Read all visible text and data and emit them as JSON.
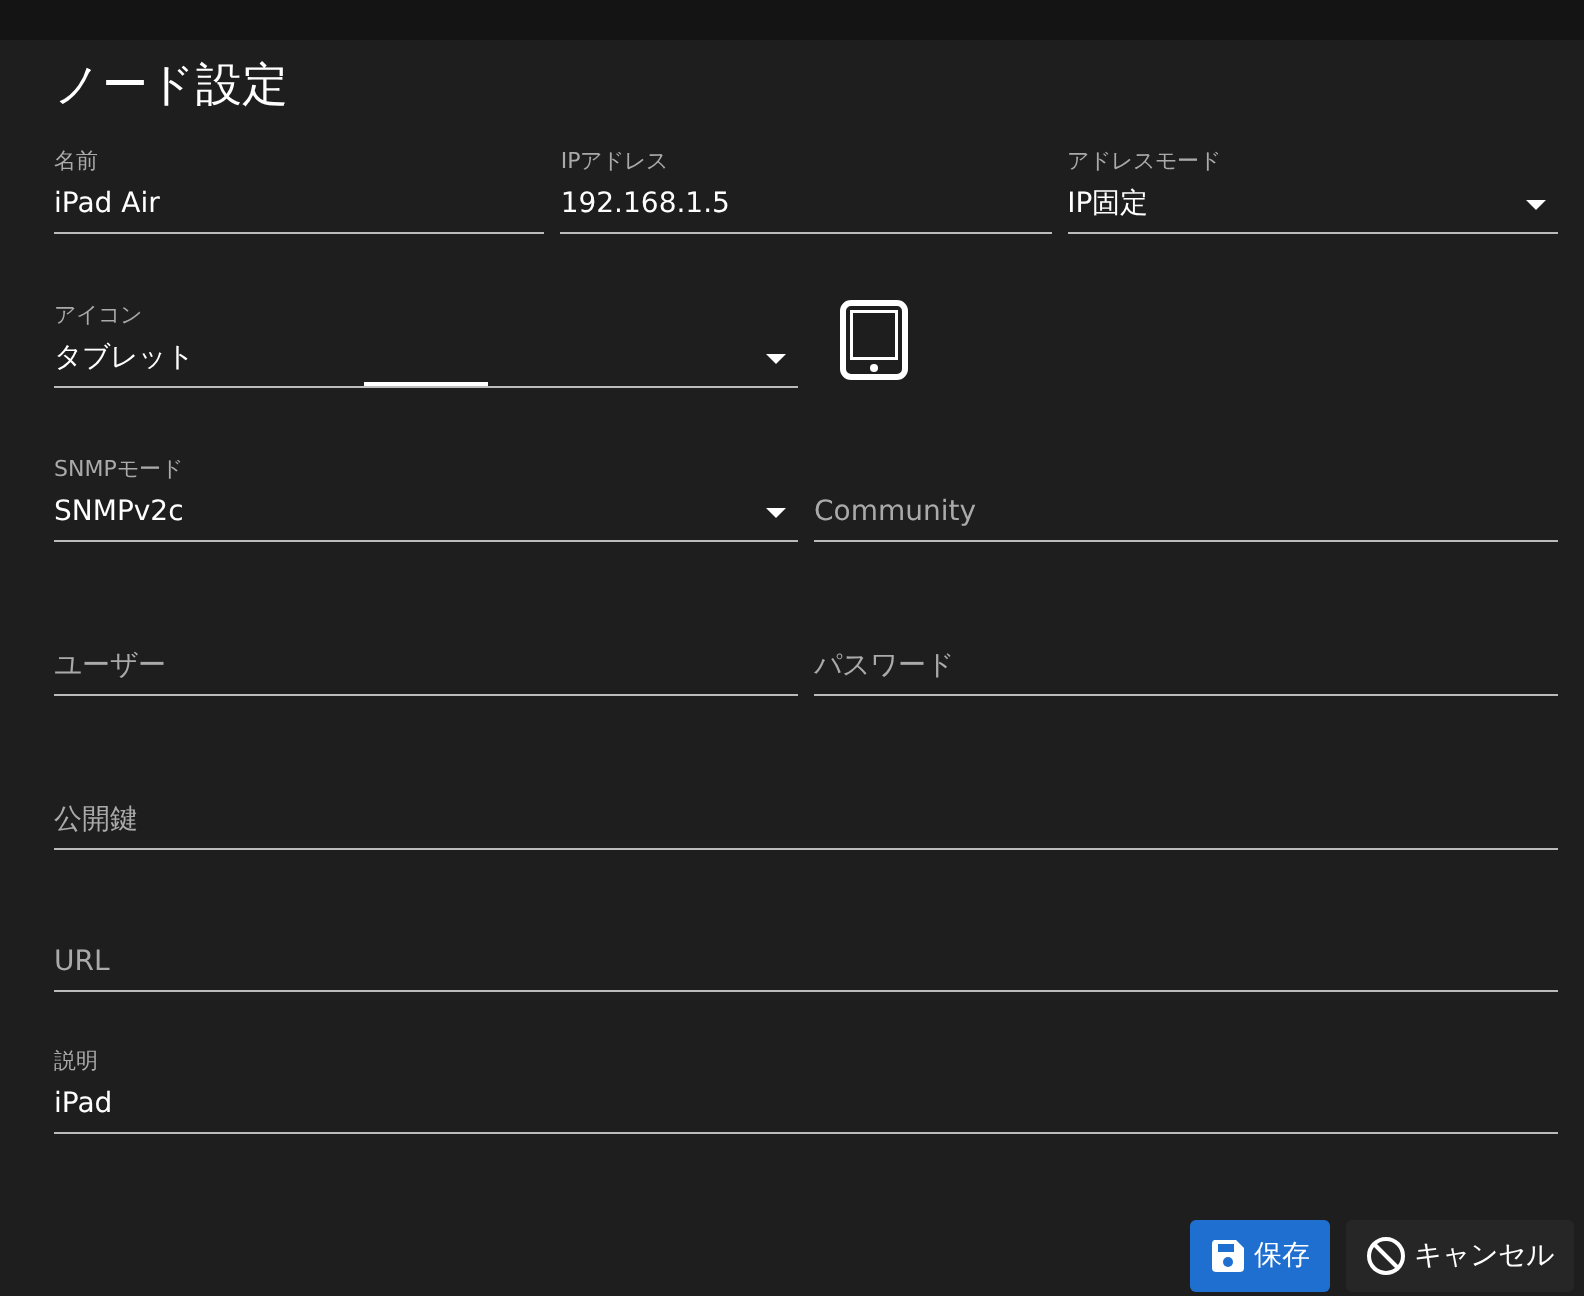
{
  "dialog": {
    "title": "ノード設定",
    "rows": [
      [
        {
          "kind": "text",
          "label": "名前",
          "value": "iPad Air",
          "focused": false
        },
        {
          "kind": "text",
          "label": "IPアドレス",
          "value": "192.168.1.5",
          "focused": false
        },
        {
          "kind": "select",
          "label": "アドレスモード",
          "value": "IP固定",
          "focused": false
        }
      ],
      [
        {
          "kind": "select",
          "label": "アイコン",
          "value": "タブレット",
          "focused": true
        },
        {
          "kind": "preview"
        }
      ],
      [
        {
          "kind": "select",
          "label": "SNMPモード",
          "value": "SNMPv2c",
          "focused": false
        },
        {
          "kind": "text",
          "placeholder": "Community",
          "focused": false
        }
      ],
      [
        {
          "kind": "text",
          "placeholder": "ユーザー",
          "focused": false
        },
        {
          "kind": "text",
          "placeholder": "パスワード",
          "focused": false
        }
      ],
      [
        {
          "kind": "text",
          "placeholder": "公開鍵",
          "focused": false
        }
      ],
      [
        {
          "kind": "text",
          "placeholder": "URL",
          "focused": false
        }
      ],
      [
        {
          "kind": "text",
          "label": "説明",
          "value": "iPad",
          "focused": false
        }
      ]
    ],
    "buttons": [
      {
        "kind": "save",
        "label": "保存"
      },
      {
        "kind": "cancel",
        "label": "キャンセル"
      }
    ]
  }
}
